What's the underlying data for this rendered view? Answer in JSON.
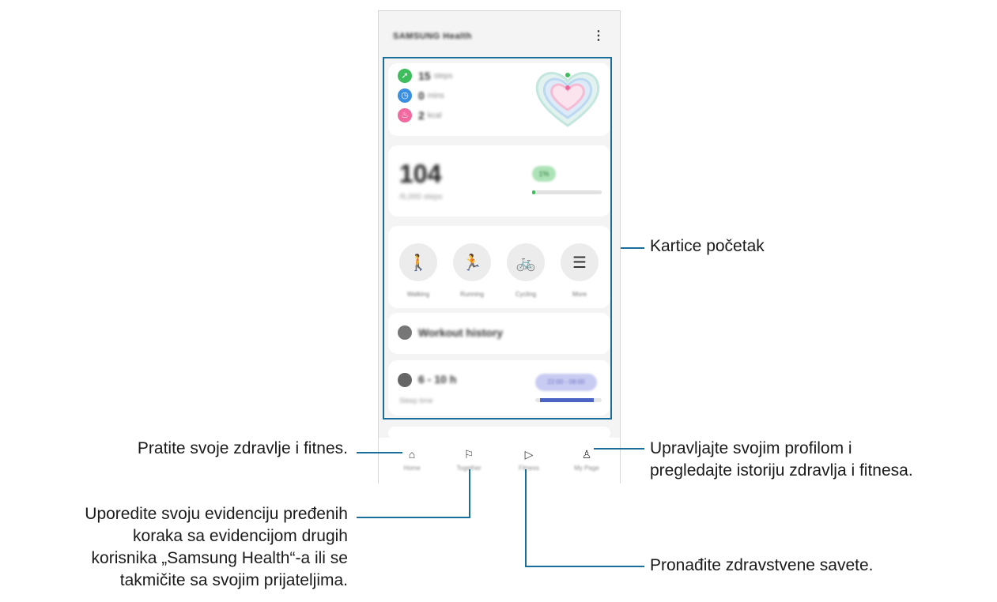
{
  "app": {
    "title": "SAMSUNG Health",
    "more_icon": "⋮"
  },
  "activity": {
    "steps": {
      "value": "15",
      "unit": "steps",
      "color": "#3dbd5b"
    },
    "minutes": {
      "value": "0",
      "unit": "mins",
      "color": "#3a8fe0"
    },
    "calories": {
      "value": "2",
      "unit": "kcal",
      "color": "#f06aa0"
    }
  },
  "steps_card": {
    "big_number": "104",
    "subtitle": "/6,000 steps",
    "badge": "1%",
    "progress": 0.04
  },
  "exercise": {
    "items": [
      {
        "label": "Walking",
        "icon": "walking-icon"
      },
      {
        "label": "Running",
        "icon": "running-icon"
      },
      {
        "label": "Cycling",
        "icon": "cycling-icon"
      },
      {
        "label": "More",
        "icon": "list-icon"
      }
    ]
  },
  "workout_history": {
    "title": "Workout history"
  },
  "sleep": {
    "value": "6 - 10",
    "unit": "h",
    "subtitle": "Sleep time",
    "range": "22:00 - 08:00"
  },
  "nav": {
    "items": [
      {
        "label": "Home",
        "icon": "home-icon"
      },
      {
        "label": "Together",
        "icon": "flag-icon"
      },
      {
        "label": "Fitness",
        "icon": "play-icon"
      },
      {
        "label": "My Page",
        "icon": "person-icon"
      }
    ]
  },
  "callouts": {
    "cards": "Kartice početak",
    "track": "Pratite svoje zdravlje i fitnes.",
    "profile_line1": "Upravljajte svojim profilom i",
    "profile_line2": "pregledajte istoriju zdravlja i fitnesa.",
    "compare_line1": "Uporedite svoju evidenciju pređenih",
    "compare_line2": "koraka sa evidencijom drugih",
    "compare_line3": "korisnika „Samsung Health“-a ili se",
    "compare_line4": "takmičite sa svojim prijateljima.",
    "tips": "Pronađite zdravstvene savete."
  },
  "colors": {
    "accent": "#1a6e9a"
  }
}
